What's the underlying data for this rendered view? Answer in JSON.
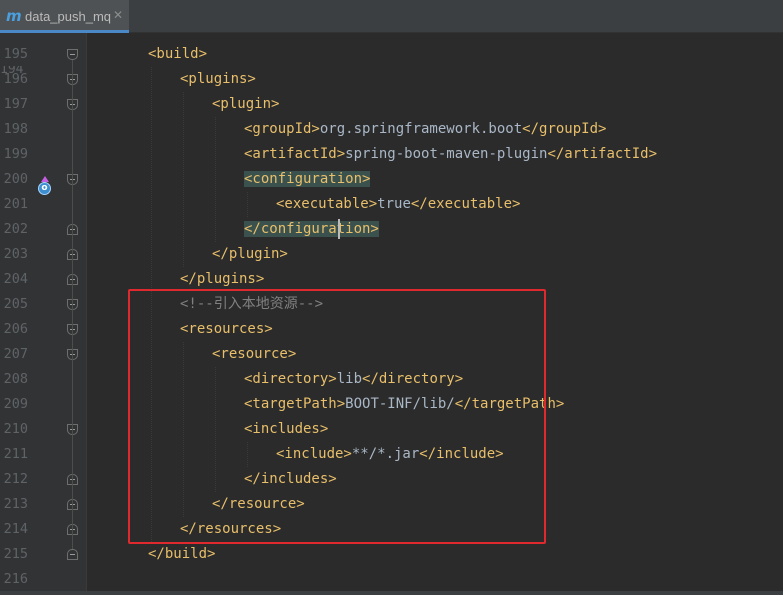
{
  "tab": {
    "icon": "m",
    "name": "data_push_mq",
    "close": "✕"
  },
  "editor": {
    "cut_line_number": "194",
    "lines": [
      {
        "num": "195",
        "indent": 1,
        "parts": [
          {
            "t": "<build>",
            "k": "tag"
          }
        ]
      },
      {
        "num": "196",
        "indent": 2,
        "parts": [
          {
            "t": "<plugins>",
            "k": "tag"
          }
        ]
      },
      {
        "num": "197",
        "indent": 3,
        "parts": [
          {
            "t": "<plugin>",
            "k": "tag"
          }
        ]
      },
      {
        "num": "198",
        "indent": 4,
        "parts": [
          {
            "t": "<groupId>",
            "k": "tag"
          },
          {
            "t": "org.springframework.boot",
            "k": "txt"
          },
          {
            "t": "</groupId>",
            "k": "tag"
          }
        ]
      },
      {
        "num": "199",
        "indent": 4,
        "parts": [
          {
            "t": "<artifactId>",
            "k": "tag"
          },
          {
            "t": "spring-boot-maven-plugin",
            "k": "txt"
          },
          {
            "t": "</artifactId>",
            "k": "tag"
          }
        ]
      },
      {
        "num": "200",
        "indent": 4,
        "parts": [
          {
            "t": "<configuration>",
            "k": "tag",
            "hl": true
          }
        ]
      },
      {
        "num": "201",
        "indent": 5,
        "parts": [
          {
            "t": "<executable>",
            "k": "tag"
          },
          {
            "t": "true",
            "k": "txt"
          },
          {
            "t": "</executable>",
            "k": "tag"
          }
        ]
      },
      {
        "num": "202",
        "indent": 4,
        "parts": [
          {
            "t": "</configuration>",
            "k": "tag",
            "hl": true
          }
        ]
      },
      {
        "num": "203",
        "indent": 3,
        "parts": [
          {
            "t": "</plugin>",
            "k": "tag"
          }
        ]
      },
      {
        "num": "204",
        "indent": 2,
        "parts": [
          {
            "t": "</plugins>",
            "k": "tag"
          }
        ]
      },
      {
        "num": "205",
        "indent": 2,
        "parts": [
          {
            "t": "<!--引入本地资源-->",
            "k": "cmt"
          }
        ]
      },
      {
        "num": "206",
        "indent": 2,
        "parts": [
          {
            "t": "<resources>",
            "k": "tag"
          }
        ]
      },
      {
        "num": "207",
        "indent": 3,
        "parts": [
          {
            "t": "<resource>",
            "k": "tag"
          }
        ]
      },
      {
        "num": "208",
        "indent": 4,
        "parts": [
          {
            "t": "<directory>",
            "k": "tag"
          },
          {
            "t": "lib",
            "k": "txt"
          },
          {
            "t": "</directory>",
            "k": "tag"
          }
        ]
      },
      {
        "num": "209",
        "indent": 4,
        "parts": [
          {
            "t": "<targetPath>",
            "k": "tag"
          },
          {
            "t": "BOOT-INF/lib/",
            "k": "txt"
          },
          {
            "t": "</targetPath>",
            "k": "tag"
          }
        ]
      },
      {
        "num": "210",
        "indent": 4,
        "parts": [
          {
            "t": "<includes>",
            "k": "tag"
          }
        ]
      },
      {
        "num": "211",
        "indent": 5,
        "parts": [
          {
            "t": "<include>",
            "k": "tag"
          },
          {
            "t": "**/*.jar",
            "k": "txt"
          },
          {
            "t": "</include>",
            "k": "tag"
          }
        ]
      },
      {
        "num": "212",
        "indent": 4,
        "parts": [
          {
            "t": "</includes>",
            "k": "tag"
          }
        ]
      },
      {
        "num": "213",
        "indent": 3,
        "parts": [
          {
            "t": "</resource>",
            "k": "tag"
          }
        ]
      },
      {
        "num": "214",
        "indent": 2,
        "parts": [
          {
            "t": "</resources>",
            "k": "tag"
          }
        ]
      },
      {
        "num": "215",
        "indent": 1,
        "parts": [
          {
            "t": "</build>",
            "k": "tag"
          }
        ]
      },
      {
        "num": "216",
        "indent": 0,
        "parts": []
      }
    ],
    "gutter_icons": [
      {
        "line": "199",
        "icon": "override-method-icon"
      }
    ]
  },
  "colors": {
    "background": "#2b2b2b",
    "gutter": "#313335",
    "tag": "#e8bf6a",
    "text": "#a9b7c6",
    "comment": "#808080",
    "brace_highlight": "#3b514d",
    "annotation_box": "#e0282f"
  }
}
